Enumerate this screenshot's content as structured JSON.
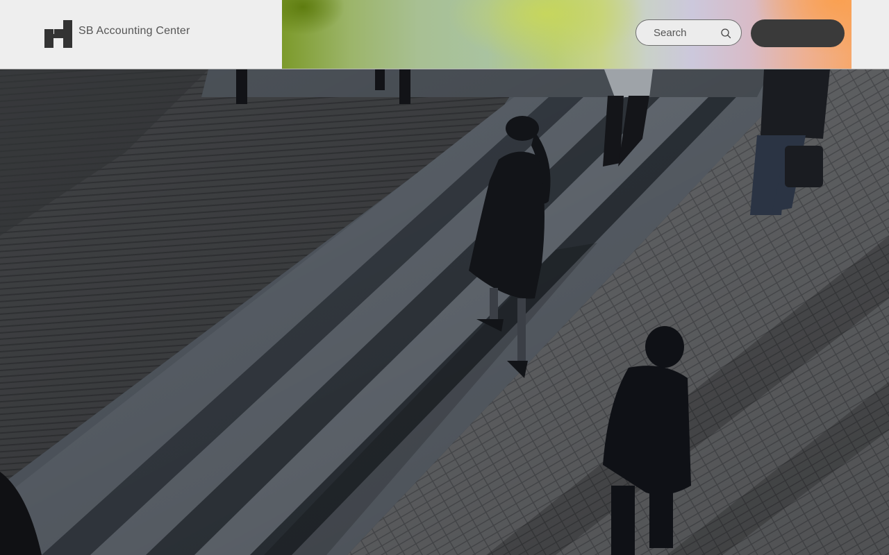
{
  "header": {
    "brand": "SB Accounting Center",
    "search": {
      "placeholder": "Search",
      "value": ""
    },
    "cta_label": ""
  },
  "hero": {
    "image": "people-walking-up-stone-steps-aerial-photo"
  },
  "icons": {
    "logo": "stepped-squares-logo-icon",
    "search": "magnifier-icon"
  },
  "colors": {
    "header_bg": "#eeeeee",
    "cta_bg": "#3a3a3a",
    "text": "#555555"
  }
}
